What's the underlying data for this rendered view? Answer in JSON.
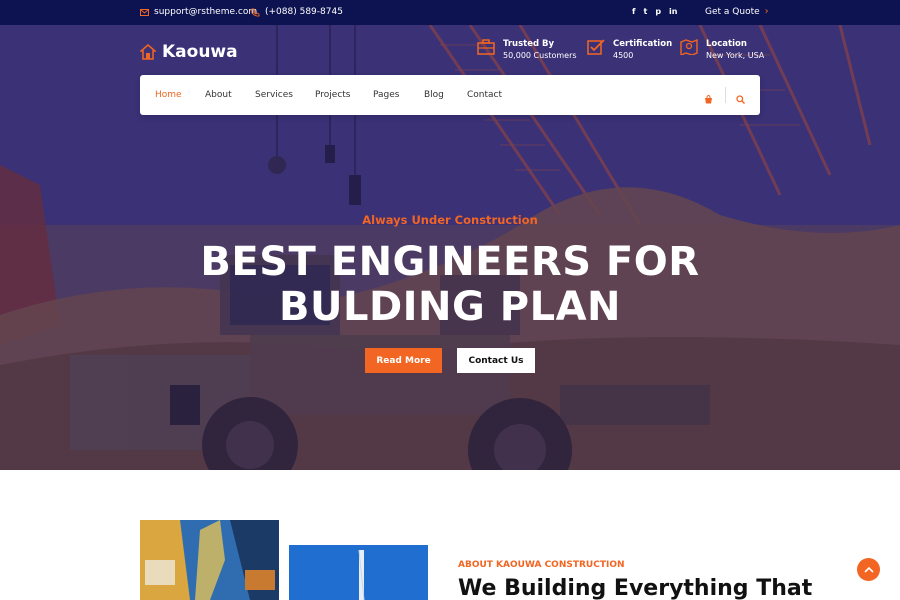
{
  "topbar": {
    "email": "support@rstheme.com",
    "phone": "(+088) 589-8745",
    "social": [
      {
        "icon": "facebook-icon",
        "glyph": "f"
      },
      {
        "icon": "twitter-icon",
        "glyph": "t"
      },
      {
        "icon": "pinterest-icon",
        "glyph": "p"
      },
      {
        "icon": "linkedin-icon",
        "glyph": "in"
      }
    ],
    "quote_label": "Get a Quote",
    "quote_arrow": "›"
  },
  "brand": {
    "name": "Kaouwa"
  },
  "info": [
    {
      "icon": "briefcase-icon",
      "title": "Trusted By",
      "text": "50,000 Customers"
    },
    {
      "icon": "checkbox-icon",
      "title": "Certification",
      "text": "4500"
    },
    {
      "icon": "map-icon",
      "title": "Location",
      "text": "New York, USA"
    }
  ],
  "nav": {
    "items": [
      "Home",
      "About",
      "Services",
      "Projects",
      "Pages",
      "Blog",
      "Contact"
    ],
    "active": "Home"
  },
  "hero": {
    "kicker": "Always Under Construction",
    "headline_line1": "BEST ENGINEERS FOR",
    "headline_line2": "BULDING PLAN",
    "primary_button": "Read More",
    "secondary_button": "Contact Us"
  },
  "about": {
    "kicker": "ABOUT KAOUWA CONSTRUCTION",
    "title": "We Building Everything That"
  },
  "colors": {
    "accent": "#f26522",
    "topbar": "#0c1350",
    "overlay": "#3a2f7a"
  }
}
